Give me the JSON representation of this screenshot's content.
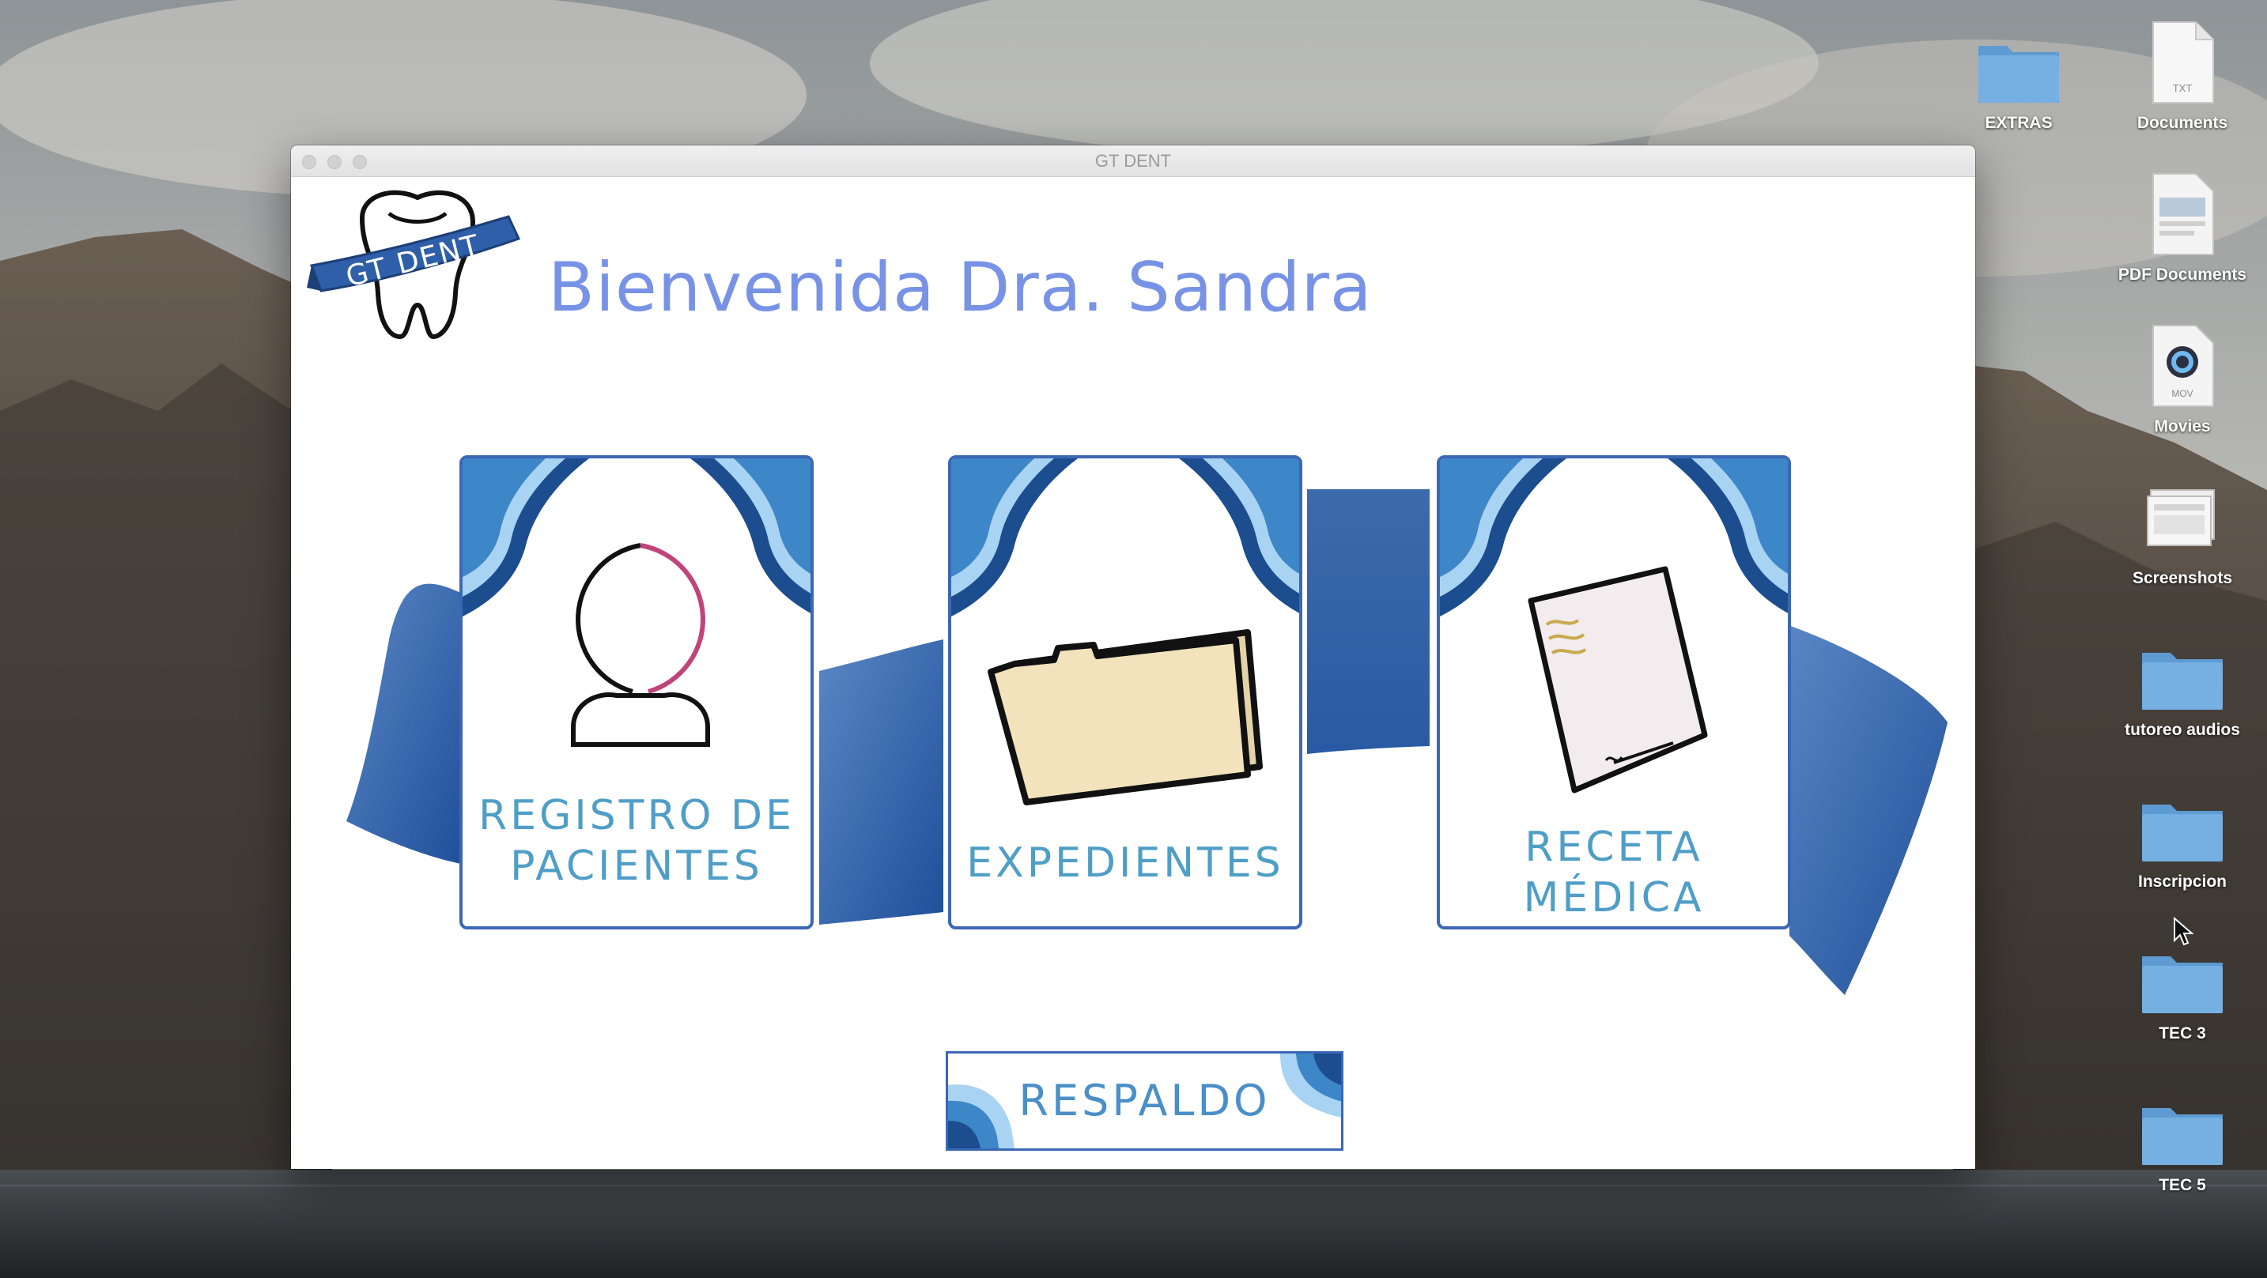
{
  "window": {
    "title": "GT DENT"
  },
  "header": {
    "logo_text": "GT DENT",
    "welcome": "Bienvenida Dra. Sandra"
  },
  "menu": {
    "registro_label": "REGISTRO DE\nPACIENTES",
    "expedientes_label": "EXPEDIENTES",
    "receta_label": "RECETA\nMÉDICA",
    "respaldo_label": "RESPALDO"
  },
  "desktop_icons": {
    "extras": "EXTRAS",
    "documents": "Documents",
    "pdf_documents": "PDF Documents",
    "movies": "Movies",
    "screenshots": "Screenshots",
    "tutoreo": "tutoreo audios",
    "inscripcion": "Inscripcion",
    "tec3": "TEC 3",
    "tec5": "TEC 5"
  },
  "file_badges": {
    "txt": "TXT",
    "mov": "MOV"
  },
  "colors": {
    "accent_blue": "#3b67b5",
    "welcome_text": "#7893e6",
    "card_label": "#4f9ec7",
    "folder_blue": "#6fa7d8"
  }
}
